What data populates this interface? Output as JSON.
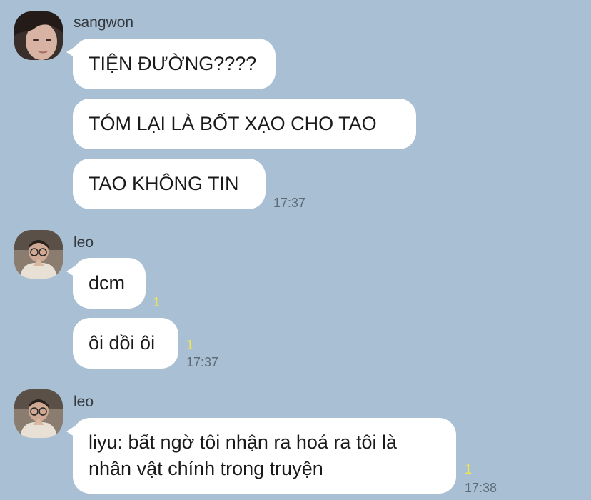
{
  "groups": [
    {
      "sender": "sangwon",
      "messages": [
        "TIỆN ĐƯỜNG????",
        "TÓM LẠI LÀ BỐT XẠO CHO TAO",
        "TAO KHÔNG TIN"
      ],
      "time": "17:37"
    },
    {
      "sender": "leo",
      "messages": [
        "dcm",
        "ôi dồi ôi"
      ],
      "read_counts": [
        "1",
        "1"
      ],
      "time": "17:37"
    },
    {
      "sender": "leo",
      "messages": [
        "liyu: bất ngờ tôi nhận ra hoá ra tôi là nhân vật chính trong truyện"
      ],
      "read_counts": [
        "1"
      ],
      "time": "17:38"
    }
  ],
  "colors": {
    "background": "#a9bfd3",
    "bubble": "#ffffff",
    "read_indicator": "#f4e64a",
    "timestamp": "#5d6b78"
  }
}
